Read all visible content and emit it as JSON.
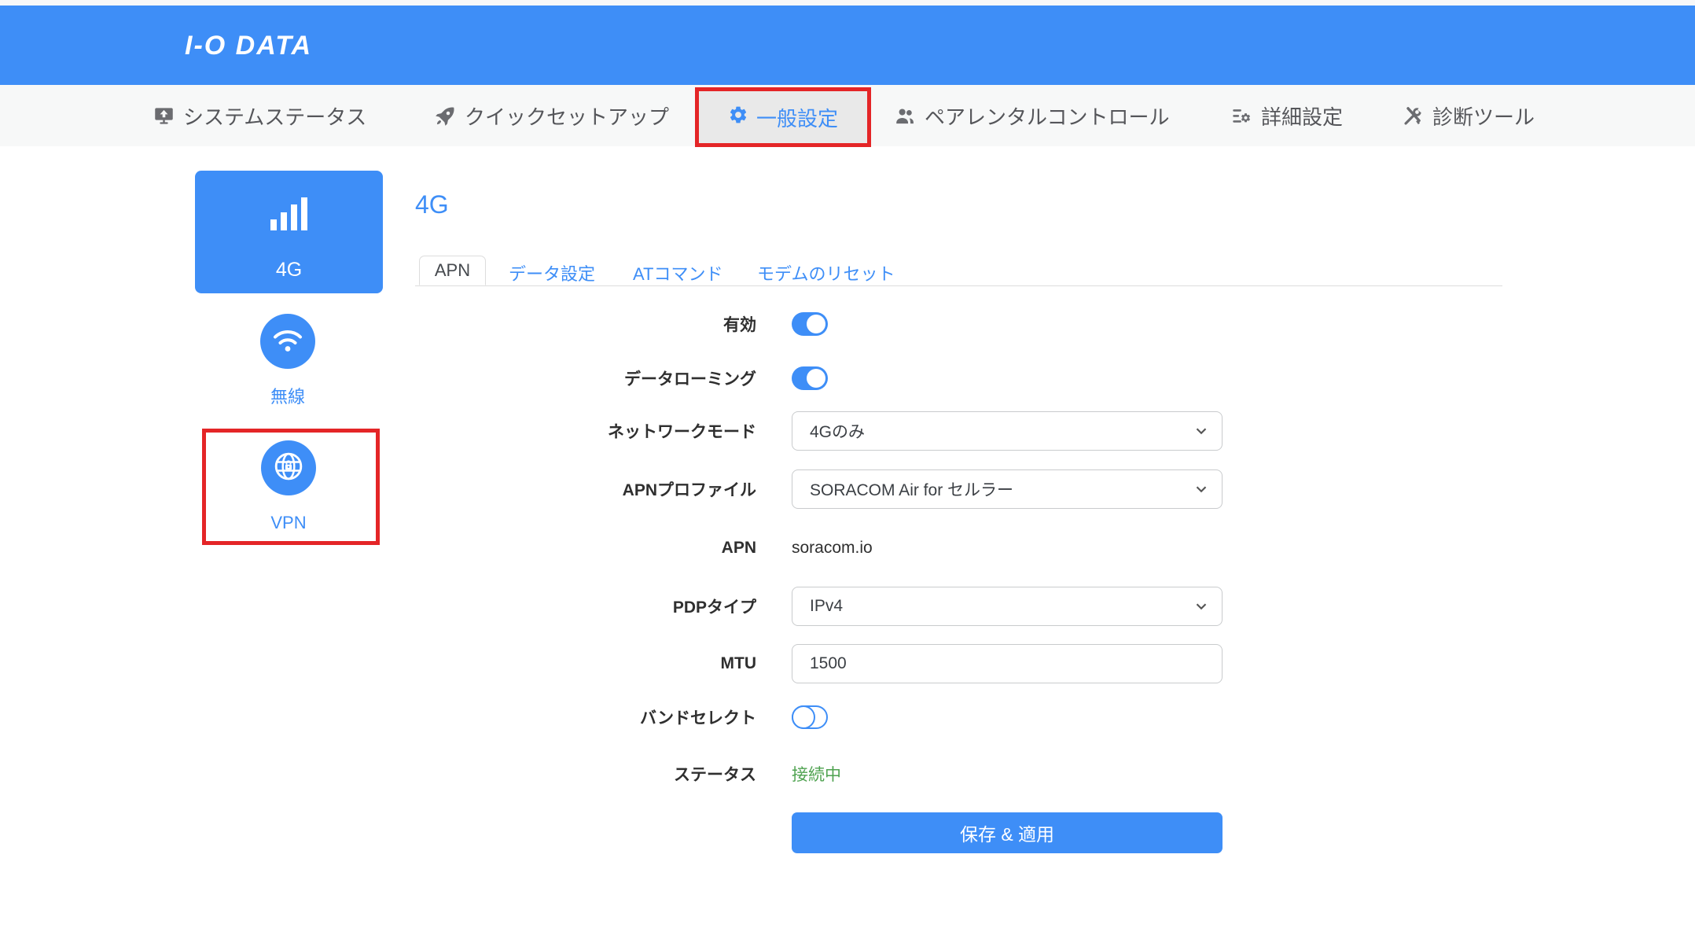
{
  "brand": {
    "logo": "I-O DATA"
  },
  "colors": {
    "primary_blue": "#3E8EF7",
    "annotation_red": "#E42527",
    "status_green": "#4EA24F",
    "nav_bg": "#f7f8f8",
    "nav_active_bg": "#e9e9e9"
  },
  "nav": {
    "items": [
      {
        "label": "システムステータス",
        "icon": "system-status-monitor-icon",
        "active": false
      },
      {
        "label": "クイックセットアップ",
        "icon": "quick-setup-rocket-icon",
        "active": false
      },
      {
        "label": "一般設定",
        "icon": "general-settings-gear-icon",
        "active": true,
        "annotated": true
      },
      {
        "label": "ペアレンタルコントロール",
        "icon": "parental-control-users-icon",
        "active": false
      },
      {
        "label": "詳細設定",
        "icon": "advanced-settings-sliders-icon",
        "active": false
      },
      {
        "label": "診断ツール",
        "icon": "diagnostic-tools-icon",
        "active": false
      }
    ]
  },
  "sidebar": {
    "items": [
      {
        "label": "4G",
        "icon": "signal-bars-icon",
        "selected": true
      },
      {
        "label": "無線",
        "icon": "wifi-icon",
        "selected": false
      },
      {
        "label": "VPN",
        "icon": "globe-lock-icon",
        "selected": false,
        "annotated": true
      }
    ]
  },
  "page": {
    "title": "4G"
  },
  "tabs": {
    "items": [
      {
        "label": "APN",
        "active": true
      },
      {
        "label": "データ設定",
        "active": false
      },
      {
        "label": "ATコマンド",
        "active": false
      },
      {
        "label": "モデムのリセット",
        "active": false
      }
    ]
  },
  "form": {
    "rows": [
      {
        "label": "有効",
        "type": "toggle",
        "value": "on"
      },
      {
        "label": "データローミング",
        "type": "toggle",
        "value": "on"
      },
      {
        "label": "ネットワークモード",
        "type": "select",
        "value": "4Gのみ"
      },
      {
        "label": "APNプロファイル",
        "type": "select",
        "value": "SORACOM Air for セルラー"
      },
      {
        "label": "APN",
        "type": "text",
        "value": "soracom.io"
      },
      {
        "label": "PDPタイプ",
        "type": "select",
        "value": "IPv4"
      },
      {
        "label": "MTU",
        "type": "input",
        "value": "1500"
      },
      {
        "label": "バンドセレクト",
        "type": "toggle",
        "value": "off"
      },
      {
        "label": "ステータス",
        "type": "status",
        "value": "接続中"
      }
    ],
    "submit_label": "保存 & 適用"
  }
}
